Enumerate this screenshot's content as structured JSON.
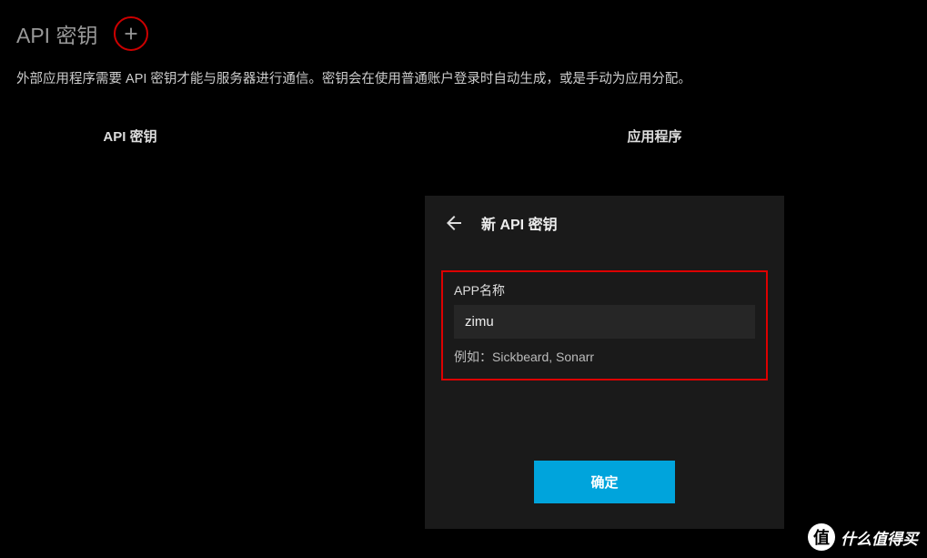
{
  "header": {
    "title": "API 密钥"
  },
  "description": "外部应用程序需要 API 密钥才能与服务器进行通信。密钥会在使用普通账户登录时自动生成，或是手动为应用分配。",
  "columns": {
    "api_key": "API 密钥",
    "application": "应用程序"
  },
  "dialog": {
    "title": "新 API 密钥",
    "field_label": "APP名称",
    "field_value": "zimu",
    "field_hint": "例如：Sickbeard, Sonarr",
    "confirm_label": "确定"
  },
  "watermark": {
    "logo": "值",
    "text": "什么值得买"
  }
}
